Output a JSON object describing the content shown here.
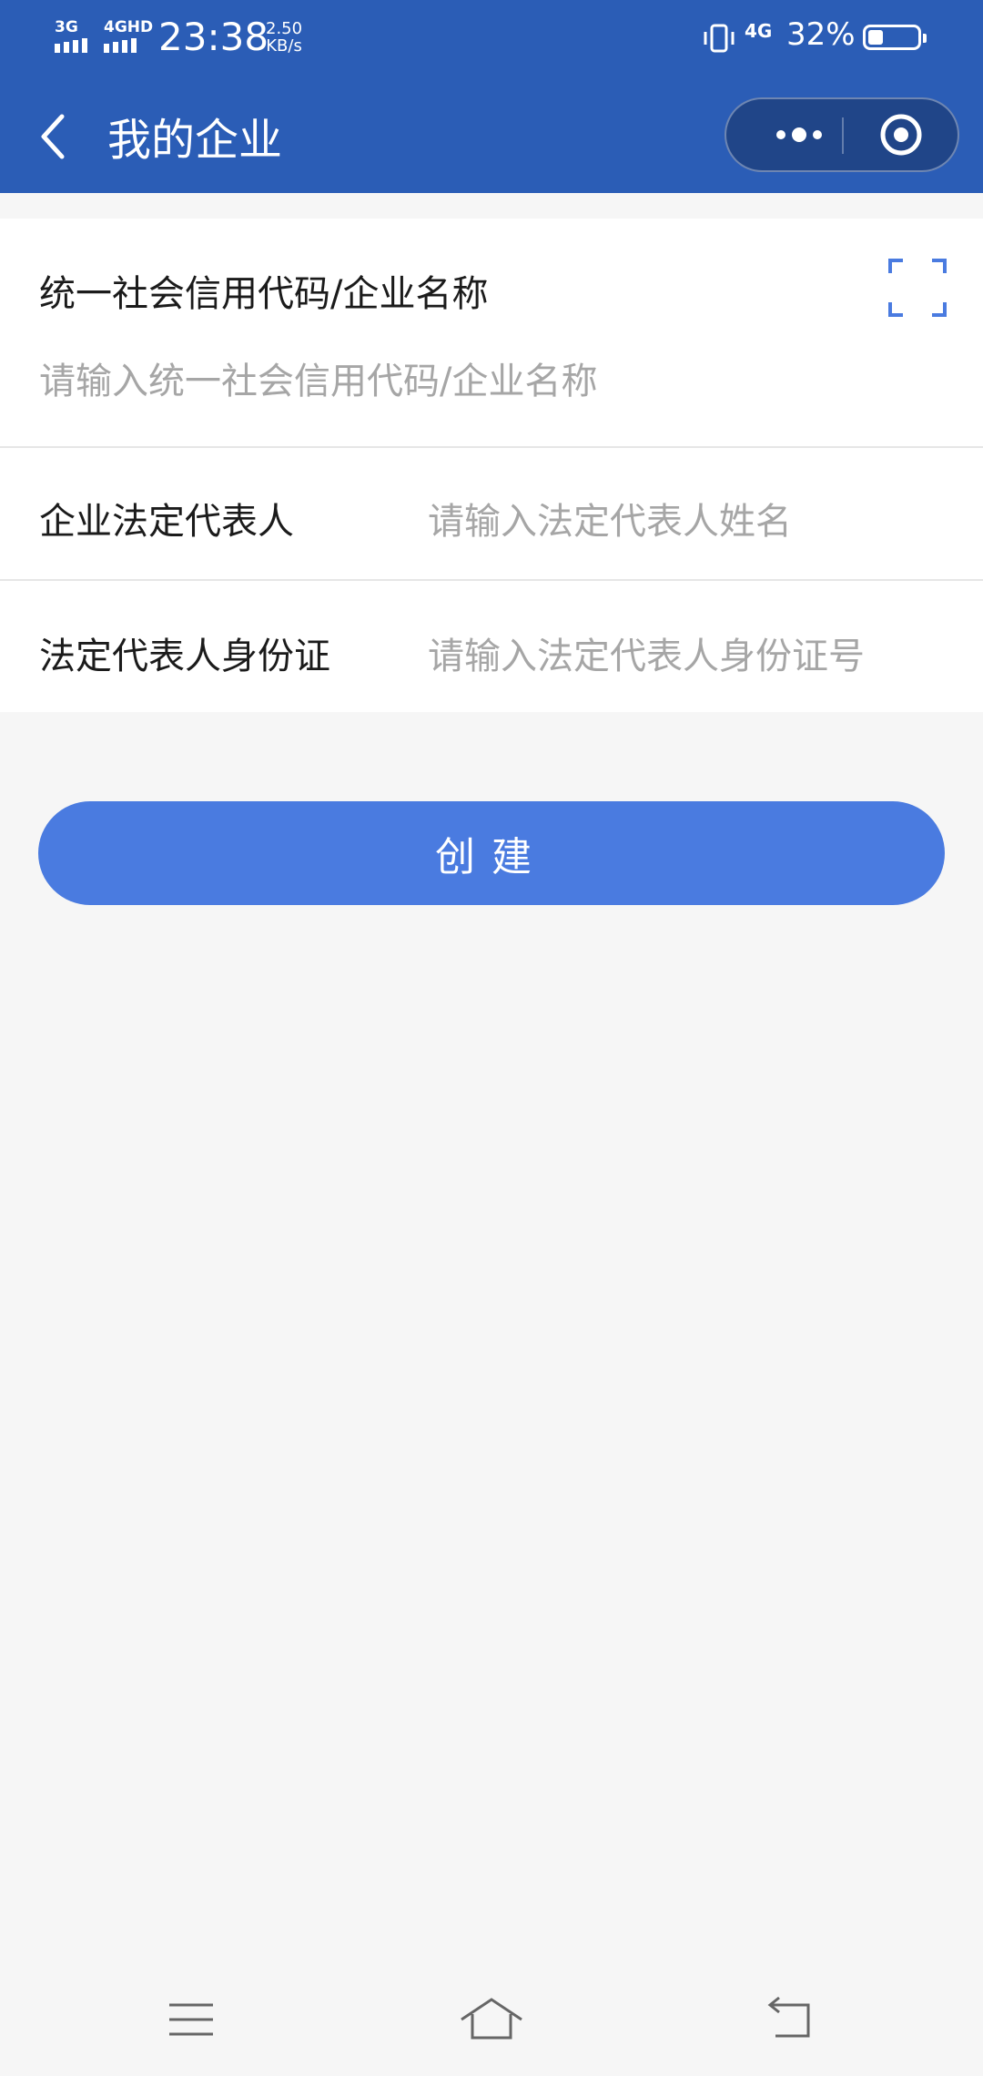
{
  "status_bar": {
    "sim1": "3G",
    "sim2": "4GHD",
    "time": "23:38",
    "speed_value": "2.50",
    "speed_unit": "KB/s",
    "network": "4G",
    "battery": "32%",
    "battery_level": 0.32
  },
  "header": {
    "title": "我的企业",
    "back_icon": "chevron-left-icon",
    "more_icon": "more-dots-icon",
    "close_icon": "target-circle-icon",
    "color": "#2b5db6"
  },
  "form": {
    "code_label": "统一社会信用代码/企业名称",
    "code_placeholder": "请输入统一社会信用代码/企业名称",
    "scan_icon": "scan-frame-icon",
    "legal_rep_label": "企业法定代表人",
    "legal_rep_placeholder": "请输入法定代表人姓名",
    "id_label": "法定代表人身份证",
    "id_placeholder": "请输入法定代表人身份证号"
  },
  "actions": {
    "create_label": "创建",
    "button_color": "#4a7be0"
  },
  "system_nav": {
    "menu_icon": "menu-icon",
    "home_icon": "home-icon",
    "back_icon": "back-arrow-icon"
  }
}
